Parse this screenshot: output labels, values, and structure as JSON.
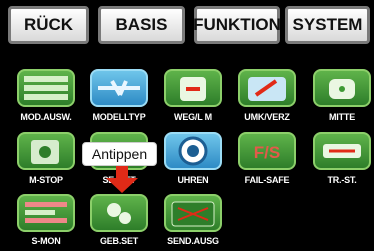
{
  "tabs": [
    "RÜCK",
    "BASIS",
    "FUNKTION",
    "SYSTEM"
  ],
  "tiles": [
    {
      "label": "MOD.AUSW.",
      "icon": "model-select-icon"
    },
    {
      "label": "MODELLTYP",
      "icon": "model-type-icon"
    },
    {
      "label": "WEG/L M",
      "icon": "servo-travel-icon"
    },
    {
      "label": "UMK/VERZ",
      "icon": "reverse-delay-icon"
    },
    {
      "label": "MITTE",
      "icon": "center-icon"
    },
    {
      "label": "M-STOP",
      "icon": "motor-stop-icon"
    },
    {
      "label": "SE..SET",
      "icon": "servo-setting-icon"
    },
    {
      "label": "UHREN",
      "icon": "timer-icon"
    },
    {
      "label": "FAIL-SAFE",
      "icon": "fail-safe-icon",
      "icon_text": "F/S"
    },
    {
      "label": "TR.-ST.",
      "icon": "trim-step-icon"
    },
    {
      "label": "S-MON",
      "icon": "servo-monitor-icon"
    },
    {
      "label": "GEB.SET",
      "icon": "transmitter-settings-icon"
    },
    {
      "label": "SEND.AUSG",
      "icon": "transmitter-output-icon"
    }
  ],
  "callout": {
    "text": "Antippen"
  },
  "colors": {
    "tile_green": "#3f9a35",
    "tile_blue": "#3aa0d8",
    "arrow_red": "#e12a17",
    "background": "#000000"
  }
}
